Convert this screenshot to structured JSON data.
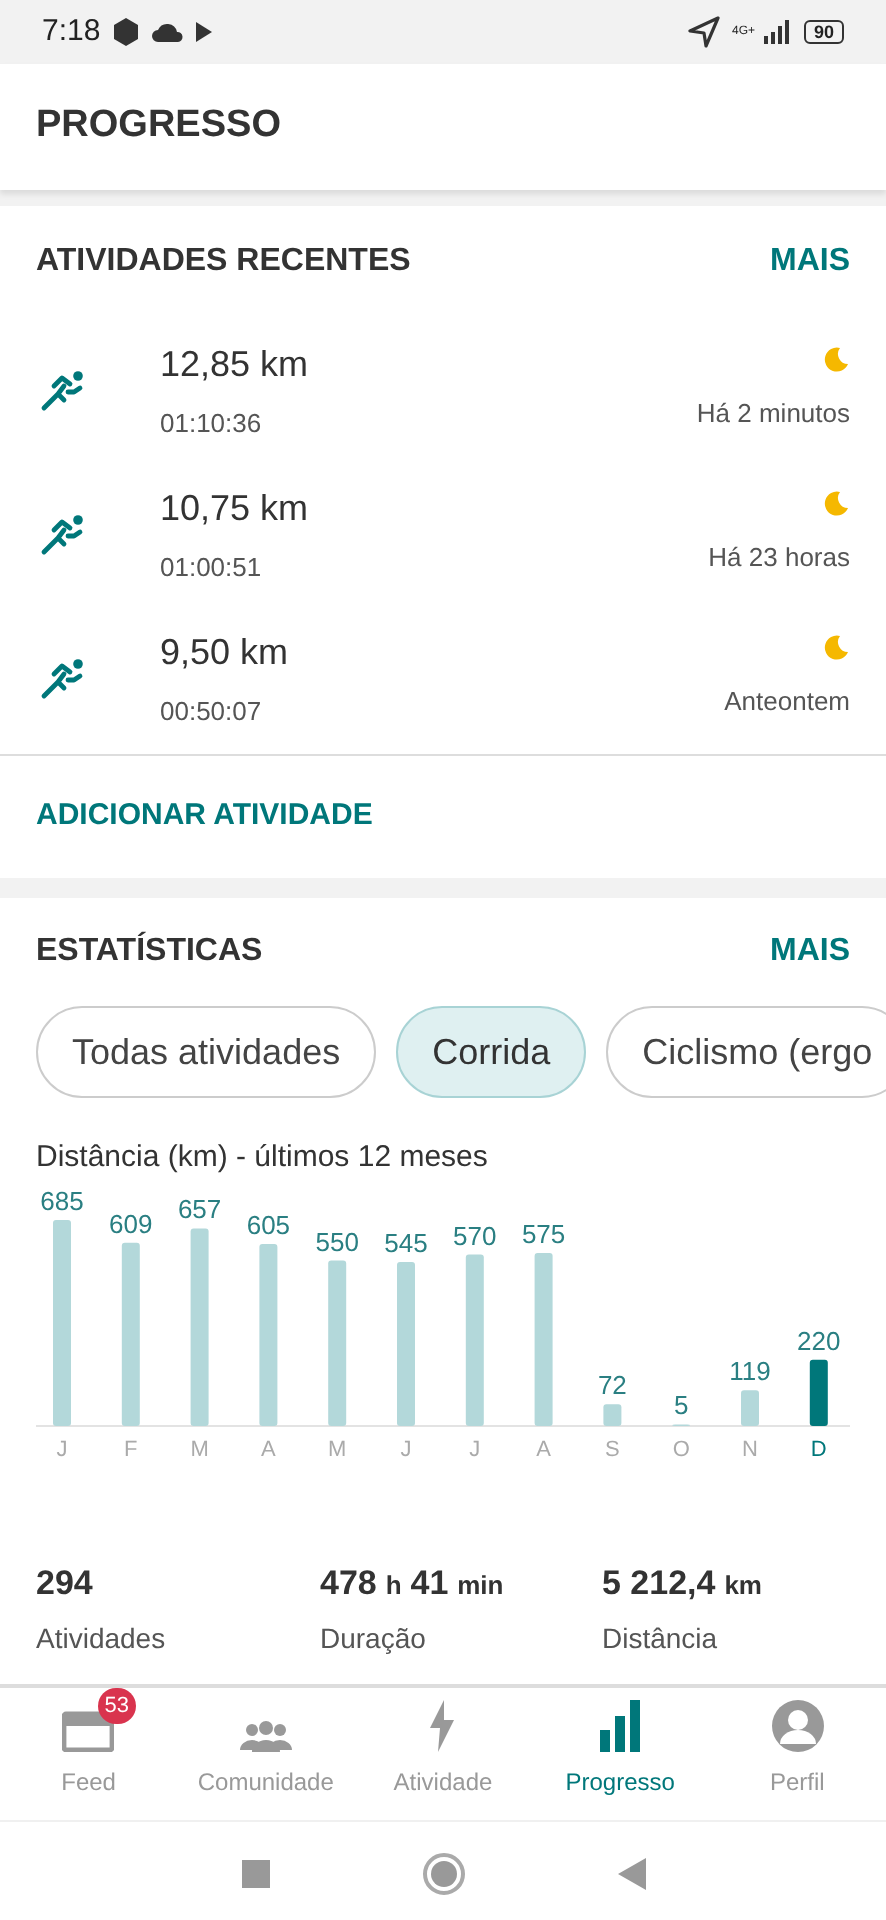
{
  "status_bar": {
    "time": "7:18",
    "battery": "90",
    "network": "4G+"
  },
  "header": {
    "title": "PROGRESSO"
  },
  "recent": {
    "title": "ATIVIDADES RECENTES",
    "more": "MAIS",
    "items": [
      {
        "distance": "12,85 km",
        "duration": "01:10:36",
        "when": "Há 2 minutos"
      },
      {
        "distance": "10,75 km",
        "duration": "01:00:51",
        "when": "Há 23 horas"
      },
      {
        "distance": "9,50 km",
        "duration": "00:50:07",
        "when": "Anteontem"
      }
    ],
    "add": "ADICIONAR ATIVIDADE"
  },
  "stats": {
    "title": "ESTATÍSTICAS",
    "more": "MAIS",
    "filters": [
      {
        "label": "Todas atividades",
        "selected": false
      },
      {
        "label": "Corrida",
        "selected": true
      },
      {
        "label": "Ciclismo (ergo",
        "selected": false
      }
    ],
    "chart_data": {
      "type": "bar",
      "title": "Distância (km) - últimos 12 meses",
      "categories": [
        "J",
        "F",
        "M",
        "A",
        "M",
        "J",
        "J",
        "A",
        "S",
        "O",
        "N",
        "D"
      ],
      "series": [
        {
          "color": "#b3d8da",
          "values": [
            685,
            609,
            657,
            605,
            550,
            545,
            570,
            575,
            72,
            5,
            119,
            null
          ]
        },
        {
          "color": "#00777a",
          "values": [
            null,
            null,
            null,
            null,
            null,
            null,
            null,
            null,
            null,
            null,
            null,
            220
          ]
        }
      ],
      "stacked": true,
      "data_labels": true
    },
    "totals": [
      {
        "parts": [
          {
            "value": "294"
          }
        ],
        "label": "Atividades"
      },
      {
        "parts": [
          {
            "value": "478",
            "unit": "h"
          },
          {
            "value": "41",
            "unit": "min"
          }
        ],
        "label": "Duração"
      },
      {
        "parts": [
          {
            "value": "5 212,4",
            "unit": "km"
          }
        ],
        "label": "Distância"
      }
    ]
  },
  "bottom_nav": [
    {
      "label": "Feed",
      "badge": "53",
      "selected": false
    },
    {
      "label": "Comunidade",
      "selected": false
    },
    {
      "label": "Atividade",
      "selected": false
    },
    {
      "label": "Progresso",
      "selected": true
    },
    {
      "label": "Perfil",
      "selected": false
    }
  ]
}
